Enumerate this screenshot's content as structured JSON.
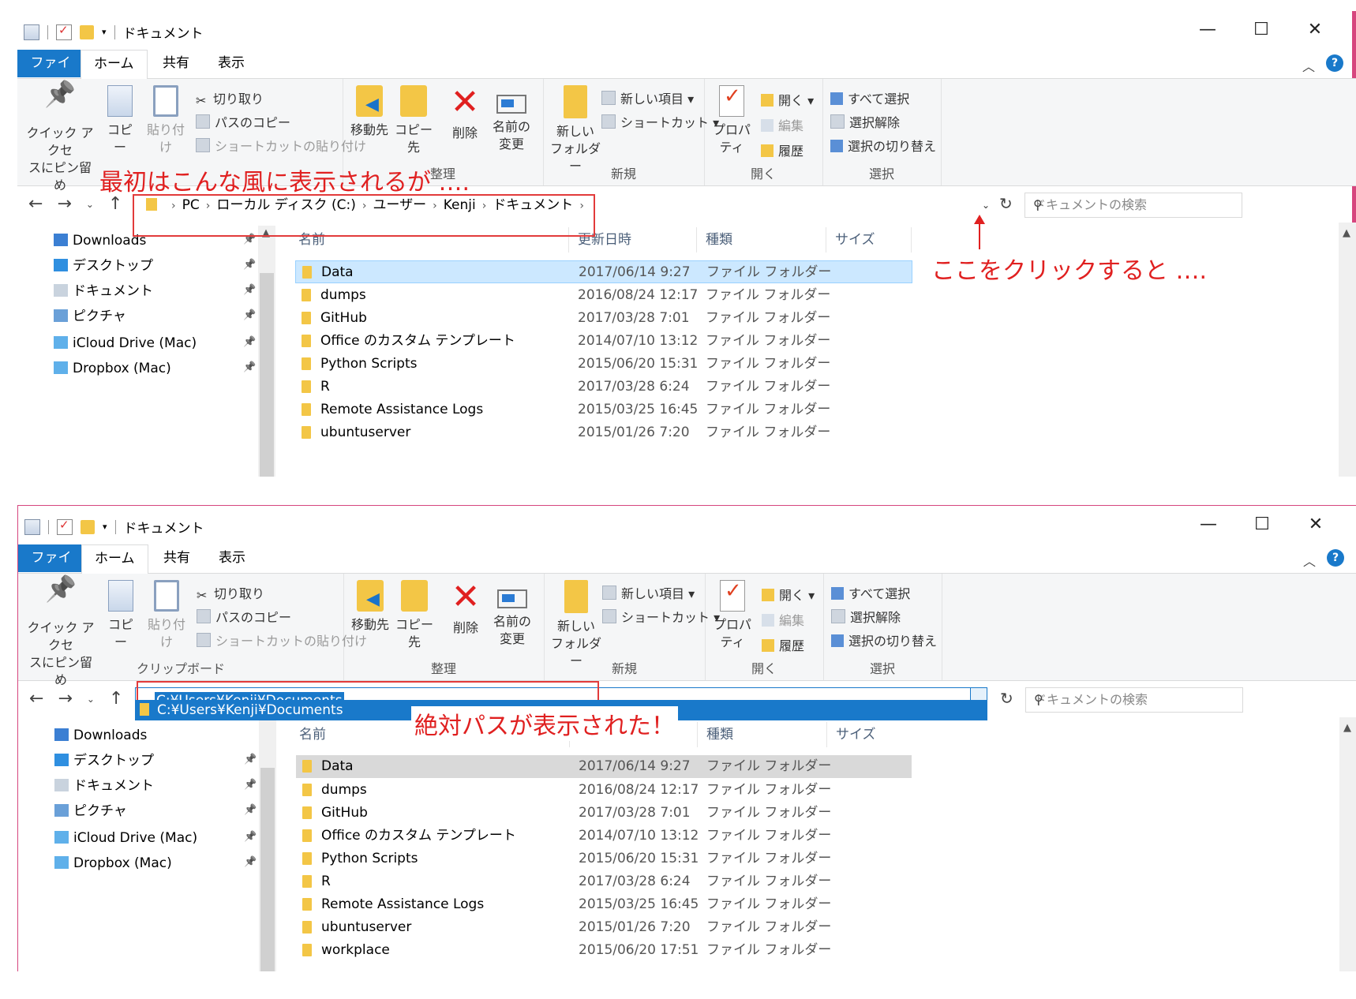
{
  "window": {
    "title": "ドキュメント",
    "buttons": {
      "minimize": "—",
      "maximize": "☐",
      "close": "✕"
    }
  },
  "tabs": {
    "file": "ファイル",
    "home": "ホーム",
    "share": "共有",
    "view": "表示"
  },
  "ribbon": {
    "clipboard": {
      "pin": "クイック アクセ\nスにピン留め",
      "copy": "コピー",
      "paste": "貼り付け",
      "cut": "切り取り",
      "copy_path": "パスのコピー",
      "paste_shortcut": "ショートカットの貼り付け",
      "group": "クリップボード"
    },
    "organize": {
      "move_to": "移動先",
      "copy_to": "コピー先",
      "delete": "削除",
      "rename": "名前の\n変更",
      "group": "整理"
    },
    "new": {
      "new_folder": "新しい\nフォルダー",
      "new_item": "新しい項目 ▾",
      "shortcut": "ショートカット ▾",
      "group": "新規"
    },
    "open": {
      "properties": "プロパティ",
      "open": "開く ▾",
      "edit": "編集",
      "history": "履歴",
      "group": "開く"
    },
    "select": {
      "select_all": "すべて選択",
      "select_none": "選択解除",
      "invert": "選択の切り替え",
      "group": "選択"
    }
  },
  "address": {
    "breadcrumbs": [
      "PC",
      "ローカル ディスク (C:)",
      "ユーザー",
      "Kenji",
      "ドキュメント"
    ],
    "path": "C:¥Users¥Kenji¥Documents"
  },
  "search": {
    "placeholder": "ドキュメントの検索"
  },
  "nav_items": [
    {
      "label": "Downloads"
    },
    {
      "label": "デスクトップ"
    },
    {
      "label": "ドキュメント"
    },
    {
      "label": "ピクチャ"
    },
    {
      "label": "iCloud Drive (Mac)"
    },
    {
      "label": "Dropbox (Mac)"
    }
  ],
  "columns": {
    "name": "名前",
    "modified": "更新日時",
    "type": "種類",
    "size": "サイズ"
  },
  "files": [
    {
      "name": "Data",
      "date": "2017/06/14 9:27",
      "type": "ファイル フォルダー"
    },
    {
      "name": "dumps",
      "date": "2016/08/24 12:17",
      "type": "ファイル フォルダー"
    },
    {
      "name": "GitHub",
      "date": "2017/03/28 7:01",
      "type": "ファイル フォルダー"
    },
    {
      "name": "Office のカスタム テンプレート",
      "date": "2014/07/10 13:12",
      "type": "ファイル フォルダー"
    },
    {
      "name": "Python Scripts",
      "date": "2015/06/20 15:31",
      "type": "ファイル フォルダー"
    },
    {
      "name": "R",
      "date": "2017/03/28 6:24",
      "type": "ファイル フォルダー"
    },
    {
      "name": "Remote Assistance Logs",
      "date": "2015/03/25 16:45",
      "type": "ファイル フォルダー"
    },
    {
      "name": "ubuntuserver",
      "date": "2015/01/26 7:20",
      "type": "ファイル フォルダー"
    },
    {
      "name": "workplace",
      "date": "2015/06/20 17:51",
      "type": "ファイル フォルダー"
    }
  ],
  "annotations": {
    "first_shown": "最初はこんな風に表示されるが ….",
    "click_here": "ここをクリックすると ….",
    "absolute_path": "絶対パスが表示された！"
  },
  "colors": {
    "accent": "#1979ca",
    "annotation": "#e02020",
    "selection": "#cce8ff"
  }
}
